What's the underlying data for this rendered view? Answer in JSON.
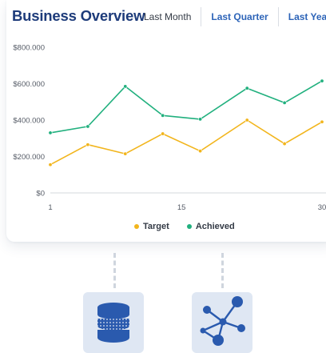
{
  "header": {
    "title": "Business Overview",
    "tabs": [
      {
        "label": "Last Month",
        "style": "plain"
      },
      {
        "label": "Last Quarter",
        "style": "link"
      },
      {
        "label": "Last Year",
        "style": "link"
      }
    ]
  },
  "chart_data": {
    "type": "line",
    "title": "Business Overview",
    "x": [
      1,
      5,
      9,
      13,
      17,
      22,
      26,
      30
    ],
    "xticks": [
      1,
      15,
      30
    ],
    "xlim": [
      1,
      30
    ],
    "yticks": [
      0,
      200000,
      400000,
      600000,
      800000
    ],
    "ytick_labels": [
      "$0",
      "$200.000",
      "$400.000",
      "$600.000",
      "$800.000"
    ],
    "ylim": [
      0,
      800000
    ],
    "grid": false,
    "legend_position": "bottom",
    "series": [
      {
        "name": "Target",
        "color": "#f2b51c",
        "values": [
          155000,
          265000,
          215000,
          325000,
          230000,
          400000,
          270000,
          390000
        ]
      },
      {
        "name": "Achieved",
        "color": "#21b07e",
        "values": [
          330000,
          365000,
          585000,
          425000,
          405000,
          575000,
          495000,
          615000
        ]
      }
    ]
  },
  "icons": [
    {
      "name": "database-icon",
      "color": "#2a5aae"
    },
    {
      "name": "network-graph-icon",
      "color": "#2a5aae"
    }
  ]
}
